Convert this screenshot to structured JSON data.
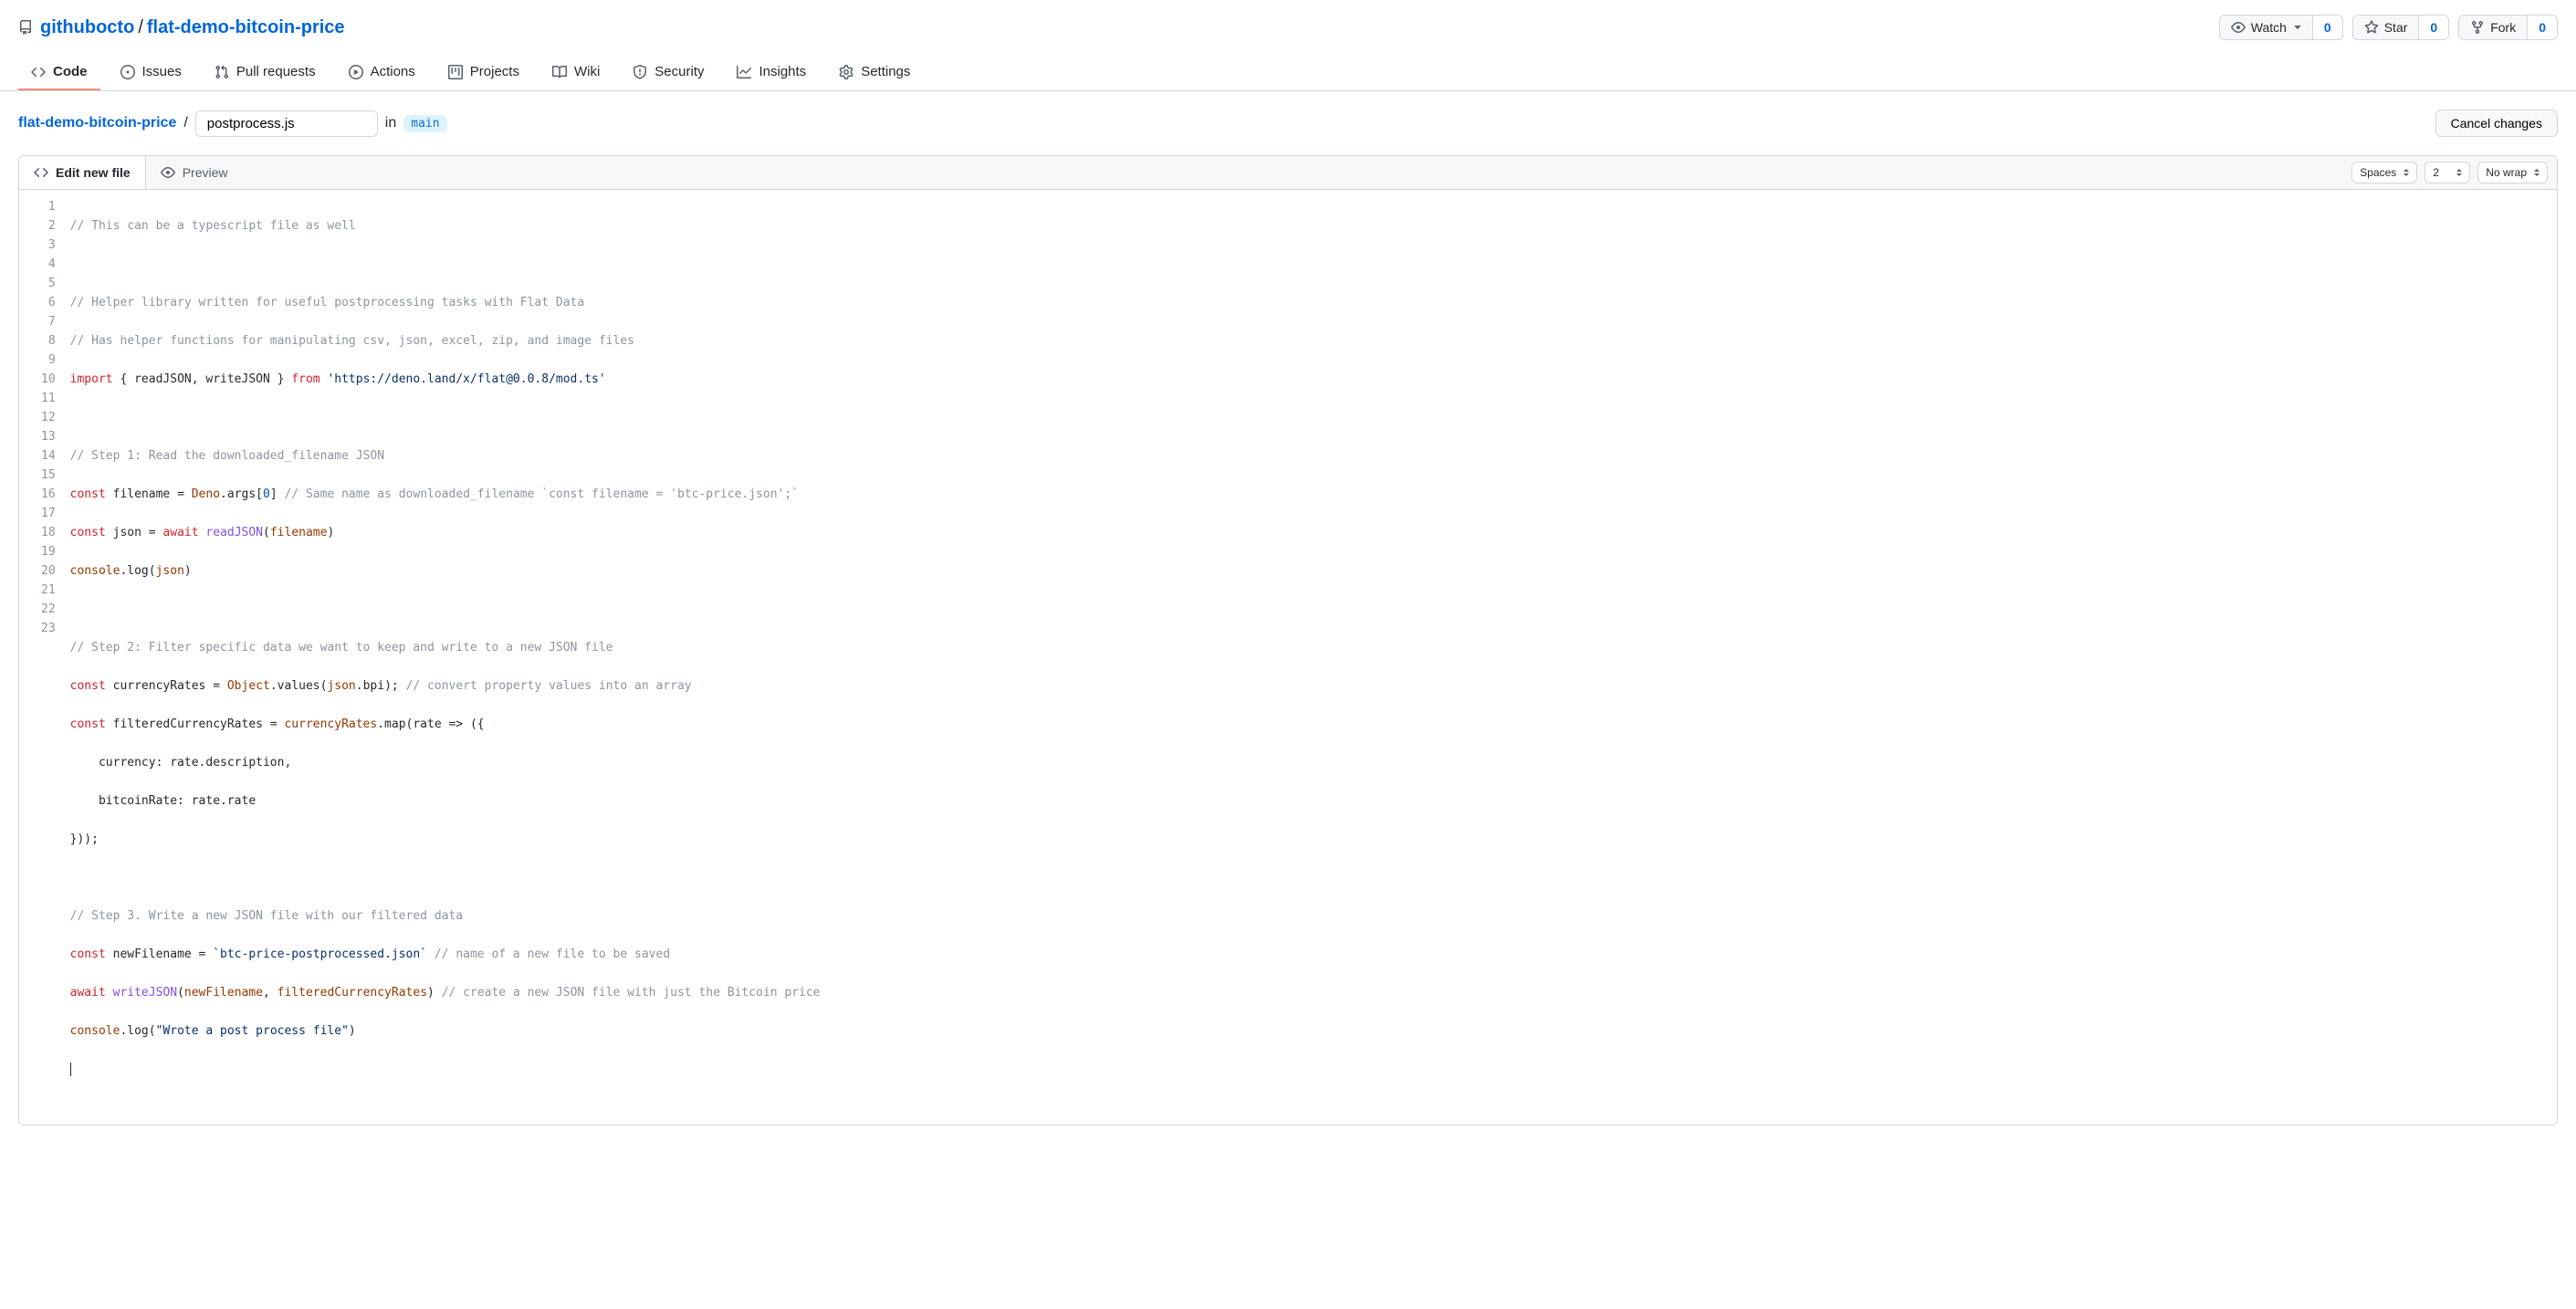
{
  "repo": {
    "owner": "githubocto",
    "name": "flat-demo-bitcoin-price"
  },
  "actions": {
    "watch": {
      "label": "Watch",
      "count": "0"
    },
    "star": {
      "label": "Star",
      "count": "0"
    },
    "fork": {
      "label": "Fork",
      "count": "0"
    }
  },
  "nav": {
    "code": "Code",
    "issues": "Issues",
    "pulls": "Pull requests",
    "actions": "Actions",
    "projects": "Projects",
    "wiki": "Wiki",
    "security": "Security",
    "insights": "Insights",
    "settings": "Settings"
  },
  "path": {
    "repo_link": "flat-demo-bitcoin-price",
    "sep": "/",
    "filename": "postprocess.js",
    "in": "in",
    "branch": "main",
    "cancel": "Cancel changes"
  },
  "editor": {
    "tab_edit": "Edit new file",
    "tab_preview": "Preview",
    "indent_mode": "Spaces",
    "indent_size": "2",
    "wrap": "No wrap"
  },
  "code": {
    "line_count": 23,
    "l1": "// This can be a typescript file as well",
    "l3": "// Helper library written for useful postprocessing tasks with Flat Data",
    "l4": "// Has helper functions for manipulating csv, json, excel, zip, and image files",
    "l5_import": "import",
    "l5_braces": " { readJSON, writeJSON } ",
    "l5_from": "from",
    "l5_url": "'https://deno.land/x/flat@0.0.8/mod.ts'",
    "l7": "// Step 1: Read the downloaded_filename JSON",
    "l8_const": "const",
    "l8_filename": " filename = ",
    "l8_deno": "Deno",
    "l8_args": ".args[",
    "l8_zero": "0",
    "l8_close": "] ",
    "l8_comment": "// Same name as downloaded_filename `const filename = 'btc-price.json';`",
    "l9_const": "const",
    "l9_a": " json = ",
    "l9_await": "await",
    "l9_sp": " ",
    "l9_fn": "readJSON",
    "l9_open": "(",
    "l9_arg": "filename",
    "l9_close": ")",
    "l10_console": "console",
    "l10_log": ".log(",
    "l10_json": "json",
    "l10_close": ")",
    "l12": "// Step 2: Filter specific data we want to keep and write to a new JSON file",
    "l13_const": "const",
    "l13_a": " currencyRates = ",
    "l13_obj": "Object",
    "l13_values": ".values(",
    "l13_json": "json",
    "l13_bpi": ".bpi); ",
    "l13_comment": "// convert property values into an array",
    "l14_const": "const",
    "l14_a": " filteredCurrencyRates = ",
    "l14_cr": "currencyRates",
    "l14_map": ".map(rate => ({",
    "l15": "    currency: rate.description,",
    "l16": "    bitcoinRate: rate.rate",
    "l17": "}));",
    "l19": "// Step 3. Write a new JSON file with our filtered data",
    "l20_const": "const",
    "l20_a": " newFilename = ",
    "l20_str": "`btc-price-postprocessed.json`",
    "l20_sp": " ",
    "l20_comment": "// name of a new file to be saved",
    "l21_await": "await",
    "l21_sp": " ",
    "l21_fn": "writeJSON",
    "l21_open": "(",
    "l21_a1": "newFilename",
    "l21_comma": ", ",
    "l21_a2": "filteredCurrencyRates",
    "l21_close": ") ",
    "l21_comment": "// create a new JSON file with just the Bitcoin price",
    "l22_console": "console",
    "l22_log": ".log(",
    "l22_str": "\"Wrote a post process file\"",
    "l22_close": ")"
  }
}
